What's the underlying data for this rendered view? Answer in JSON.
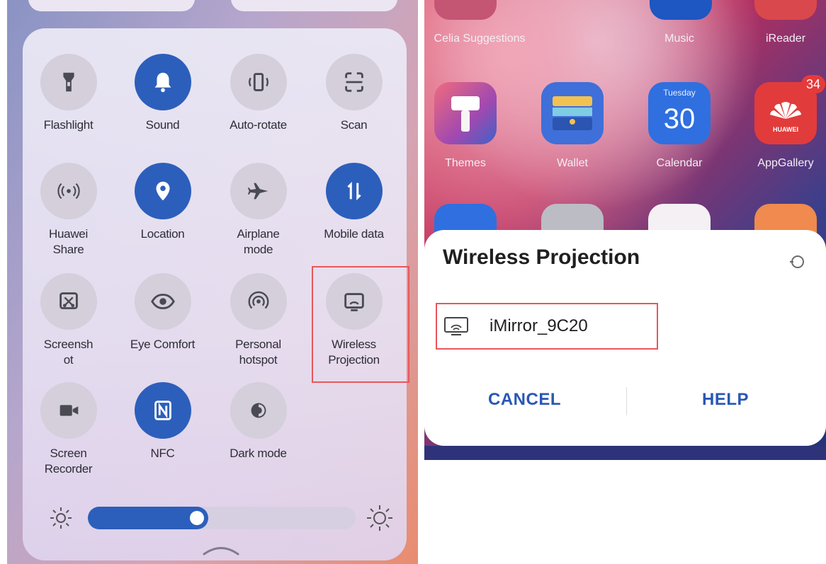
{
  "control_center": {
    "tiles": [
      {
        "label": "Flashlight",
        "icon": "flashlight-icon",
        "active": false
      },
      {
        "label": "Sound",
        "icon": "bell-icon",
        "active": true
      },
      {
        "label": "Auto-rotate",
        "icon": "auto-rotate-icon",
        "active": false
      },
      {
        "label": "Scan",
        "icon": "scan-icon",
        "active": false
      },
      {
        "label": "Huawei Share",
        "icon": "huawei-share-icon",
        "active": false
      },
      {
        "label": "Location",
        "icon": "location-pin-icon",
        "active": true
      },
      {
        "label": "Airplane mode",
        "icon": "airplane-icon",
        "active": false
      },
      {
        "label": "Mobile data",
        "icon": "mobile-data-icon",
        "active": true
      },
      {
        "label": "Screensh ot",
        "icon": "screenshot-icon",
        "active": false
      },
      {
        "label": "Eye Comfort",
        "icon": "eye-icon",
        "active": false
      },
      {
        "label": "Personal hotspot",
        "icon": "hotspot-icon",
        "active": false
      },
      {
        "label": "Wireless Projection",
        "icon": "wireless-projection-icon",
        "active": false
      },
      {
        "label": "Screen Recorder",
        "icon": "video-camera-icon",
        "active": false
      },
      {
        "label": "NFC",
        "icon": "nfc-icon",
        "active": true
      },
      {
        "label": "Dark mode",
        "icon": "dark-mode-icon",
        "active": false
      }
    ],
    "brightness_level": 0.45
  },
  "home_screen": {
    "top_labels": [
      "Celia Suggestions",
      "Music",
      "iReader"
    ],
    "apps": [
      {
        "label": "Themes",
        "icon": "themes-icon"
      },
      {
        "label": "Wallet",
        "icon": "wallet-icon"
      },
      {
        "label": "Calendar",
        "icon": "calendar-icon",
        "day": "Tuesday",
        "date": "30"
      },
      {
        "label": "AppGallery",
        "icon": "appgallery-icon",
        "badge": "34",
        "brand": "HUAWEI"
      }
    ]
  },
  "projection_dialog": {
    "title": "Wireless Projection",
    "device_name": "iMirror_9C20",
    "cancel_label": "CANCEL",
    "help_label": "HELP"
  },
  "colors": {
    "accent": "#2c5fbb",
    "highlight": "#e8565a",
    "button_text": "#2a57b4"
  }
}
